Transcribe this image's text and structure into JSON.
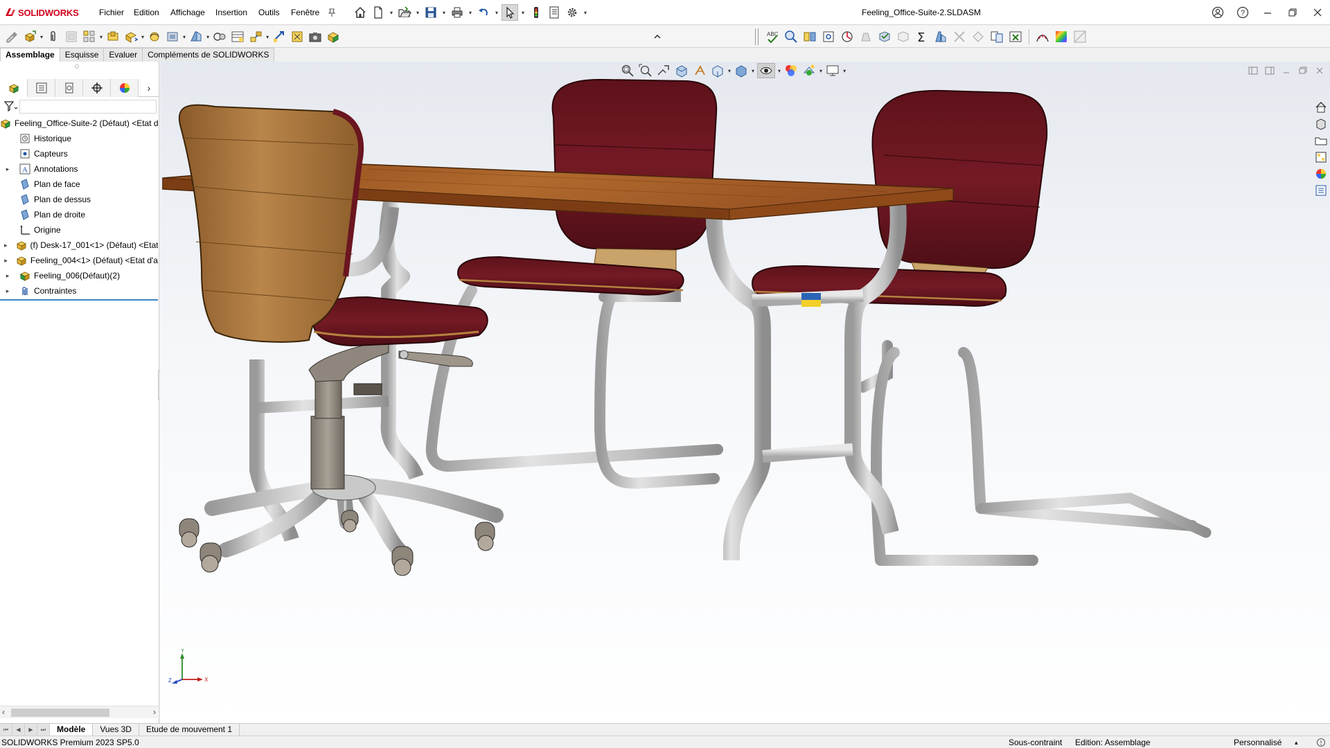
{
  "app": {
    "brand": "SOLIDWORKS",
    "document_title": "Feeling_Office-Suite-2.SLDASM"
  },
  "menu": {
    "items": [
      "Fichier",
      "Edition",
      "Affichage",
      "Insertion",
      "Outils",
      "Fenêtre"
    ]
  },
  "tabs": {
    "items": [
      "Assemblage",
      "Esquisse",
      "Evaluer",
      "Compléments de SOLIDWORKS"
    ],
    "active": "Assemblage"
  },
  "feature_tree": {
    "items": [
      {
        "label": "Feeling_Office-Suite-2 (Défaut) <Etat d",
        "icon": "assembly-icon",
        "expand": ""
      },
      {
        "label": "Historique",
        "icon": "history-icon",
        "expand": ""
      },
      {
        "label": "Capteurs",
        "icon": "sensor-icon",
        "expand": ""
      },
      {
        "label": "Annotations",
        "icon": "annotation-icon",
        "expand": "▸"
      },
      {
        "label": "Plan de face",
        "icon": "plane-icon",
        "expand": ""
      },
      {
        "label": "Plan de dessus",
        "icon": "plane-icon",
        "expand": ""
      },
      {
        "label": "Plan de droite",
        "icon": "plane-icon",
        "expand": ""
      },
      {
        "label": "Origine",
        "icon": "origin-icon",
        "expand": ""
      },
      {
        "label": "(f) Desk-17_001<1> (Défaut) <Etat",
        "icon": "subassembly-icon",
        "expand": "▸"
      },
      {
        "label": "Feeling_004<1> (Défaut) <Etat d'a",
        "icon": "subassembly-icon",
        "expand": "▸"
      },
      {
        "label": "Feeling_006(Défaut)(2)",
        "icon": "pattern-icon",
        "expand": "▸"
      },
      {
        "label": "Contraintes",
        "icon": "mates-icon",
        "expand": "▸"
      }
    ]
  },
  "bottom_tabs": {
    "items": [
      "Modèle",
      "Vues 3D",
      "Etude de mouvement 1"
    ],
    "active": "Modèle"
  },
  "status": {
    "product": "SOLIDWORKS Premium 2023 SP5.0",
    "constraint": "Sous-contraint",
    "editing": "Edition: Assemblage",
    "units": "Personnalisé"
  },
  "triad": {
    "x": "X",
    "y": "Y",
    "z": "Z"
  },
  "colors": {
    "accent": "#3c84c6",
    "brand_red": "#d0021b",
    "upholstery": "#6b1620",
    "wood": "#a9602a",
    "metal": "#c9c9c9"
  }
}
